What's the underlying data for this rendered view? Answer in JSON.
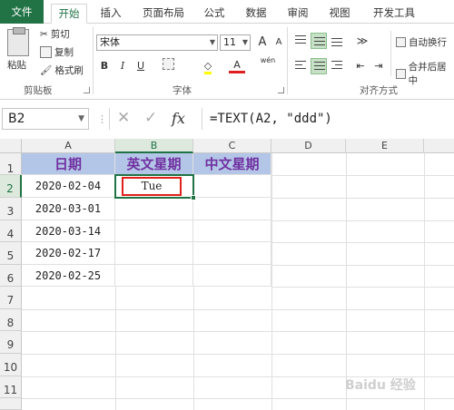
{
  "ribbon_tabs": [
    "文件",
    "开始",
    "插入",
    "页面布局",
    "公式",
    "数据",
    "审阅",
    "视图",
    "开发工具"
  ],
  "clipboard": {
    "paste": "粘贴",
    "cut": "剪切",
    "copy": "复制",
    "format_painter": "格式刷",
    "group_label": "剪贴板"
  },
  "font": {
    "name": "宋体",
    "size": "11",
    "grow": "A",
    "shrink": "A",
    "bold": "B",
    "italic": "I",
    "underline": "U",
    "font_color": "A",
    "phonetic": "wén",
    "group_label": "字体"
  },
  "alignment": {
    "wrap_text": "自动换行",
    "merge_center": "合并后居中",
    "group_label": "对齐方式"
  },
  "formula_bar": {
    "name_box": "B2",
    "formula": "=TEXT(A2, \"ddd\")",
    "fx": "fx"
  },
  "columns": [
    "A",
    "B",
    "C",
    "D",
    "E"
  ],
  "rows": [
    "1",
    "2",
    "3",
    "4",
    "5",
    "6",
    "7",
    "8",
    "9",
    "10",
    "11"
  ],
  "sheet": {
    "headers": [
      "日期",
      "英文星期",
      "中文星期"
    ],
    "dates": [
      "2020-02-04",
      "2020-03-01",
      "2020-03-14",
      "2020-02-17",
      "2020-02-25"
    ],
    "b2": "Tue"
  },
  "watermark": "Baidu 经验"
}
